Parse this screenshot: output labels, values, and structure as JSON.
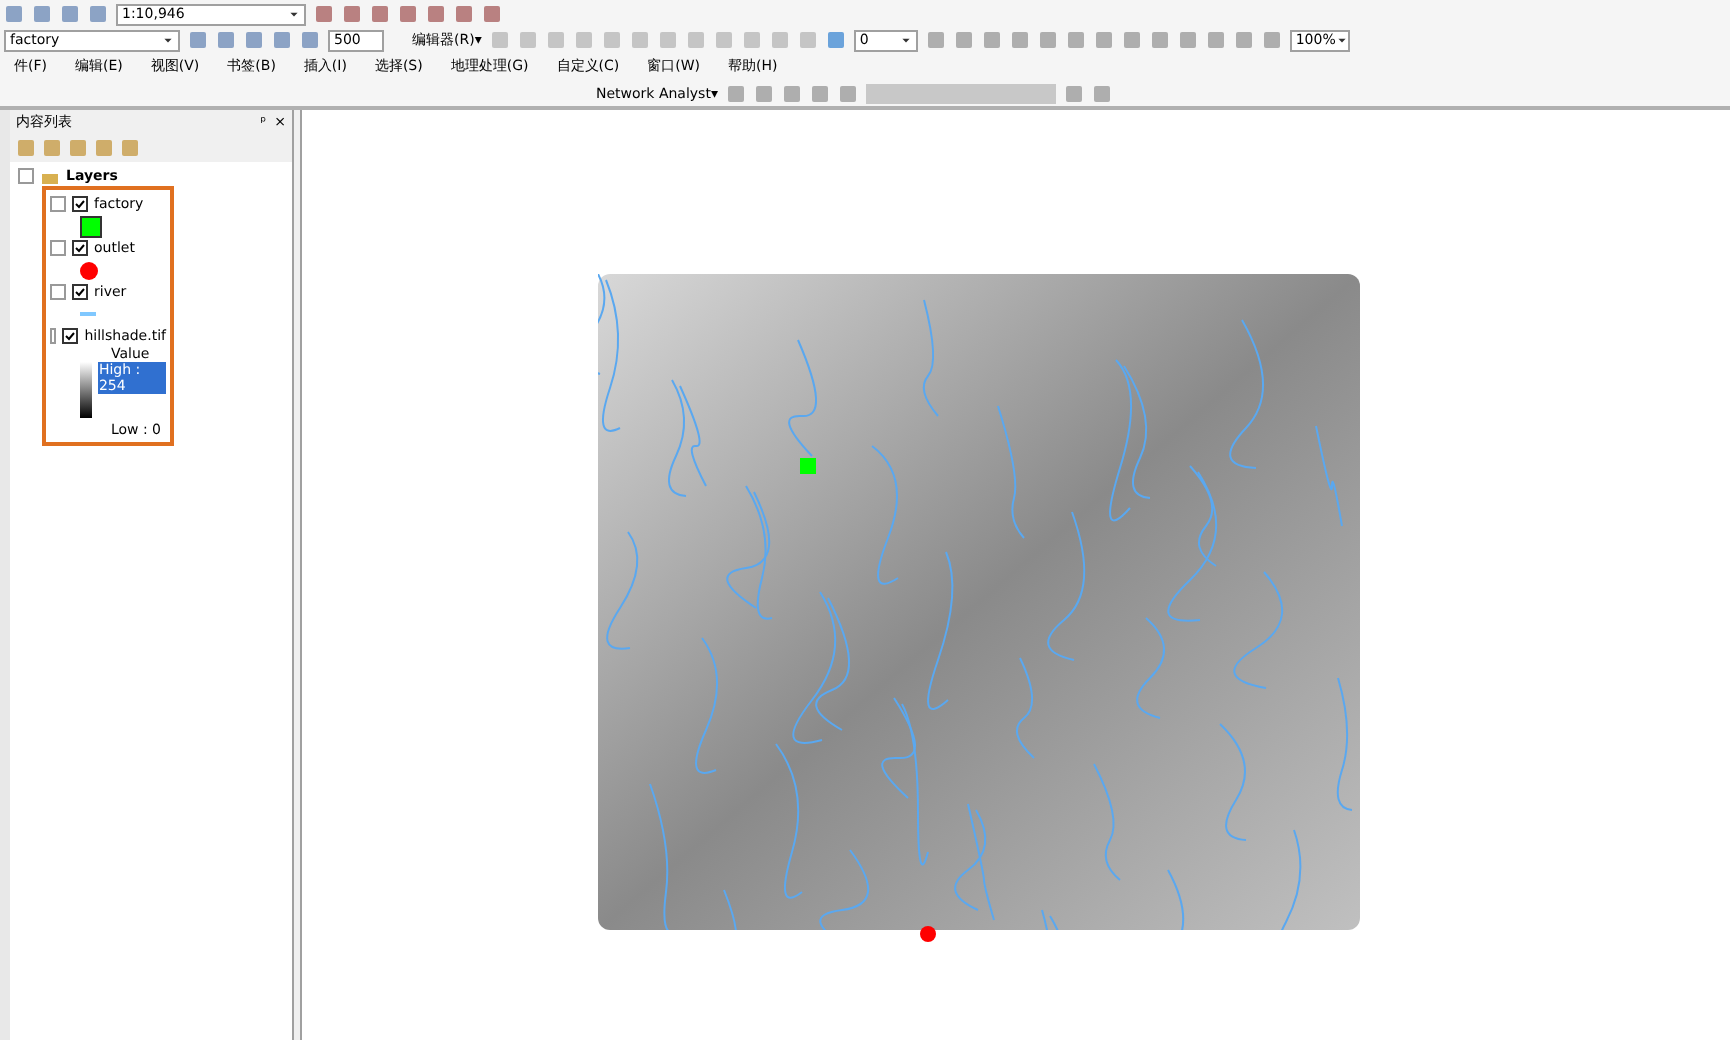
{
  "toolbar_top": {
    "scale": "1:10,946"
  },
  "toolbar_layers": {
    "layer": "factory",
    "value": "500",
    "editor_menu": "编辑器(R)▾",
    "combo": "0",
    "zoom": "100%"
  },
  "menu_bar": [
    "件(F)",
    "编辑(E)",
    "视图(V)",
    "书签(B)",
    "插入(I)",
    "选择(S)",
    "地理处理(G)",
    "自定义(C)",
    "窗口(W)",
    "帮助(H)"
  ],
  "network_toolbar": {
    "label": "Network Analyst▾"
  },
  "toc": {
    "title": "内容列表",
    "pin": "ᵖ",
    "close": "×",
    "root": {
      "name": "Layers",
      "expanded": true,
      "children": [
        {
          "name": "factory",
          "checked": true,
          "expanded": true,
          "kind": "square",
          "color": "#00ff00"
        },
        {
          "name": "outlet",
          "checked": true,
          "expanded": true,
          "kind": "circle",
          "color": "#ff0000"
        },
        {
          "name": "river",
          "checked": true,
          "expanded": true,
          "kind": "line",
          "color": "#80c8ff"
        },
        {
          "name": "hillshade.tif",
          "checked": true,
          "expanded": true,
          "kind": "ramp",
          "legend_title": "Value",
          "high": "High : 254",
          "high_selected": true,
          "low": "Low : 0"
        }
      ]
    }
  }
}
